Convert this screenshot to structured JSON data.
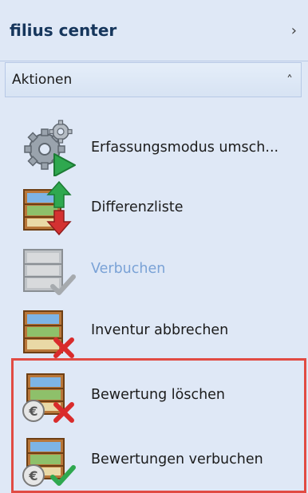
{
  "header": {
    "title": "filius center",
    "chevron_icon": "chevron-right-icon"
  },
  "group": {
    "title": "Aktionen",
    "collapse_icon": "chevron-up-icon"
  },
  "actions": [
    {
      "label": "Erfassungsmodus umsch...",
      "icon": "gears-play-icon",
      "disabled": false
    },
    {
      "label": "Differenzliste",
      "icon": "shelf-up-down-arrows-icon",
      "disabled": false
    },
    {
      "label": "Verbuchen",
      "icon": "shelf-check-icon",
      "disabled": true
    },
    {
      "label": "Inventur abbrechen",
      "icon": "shelf-cancel-icon",
      "disabled": false
    },
    {
      "label": "Bewertung löschen",
      "icon": "shelf-euro-cancel-icon",
      "disabled": false
    },
    {
      "label": "Bewertungen verbuchen",
      "icon": "shelf-euro-check-icon",
      "disabled": false
    }
  ],
  "colors": {
    "panel_background": "#dfe8f6",
    "header_title": "#16365c",
    "disabled_text": "#7aa2d6",
    "highlight_border": "#e14b43"
  }
}
